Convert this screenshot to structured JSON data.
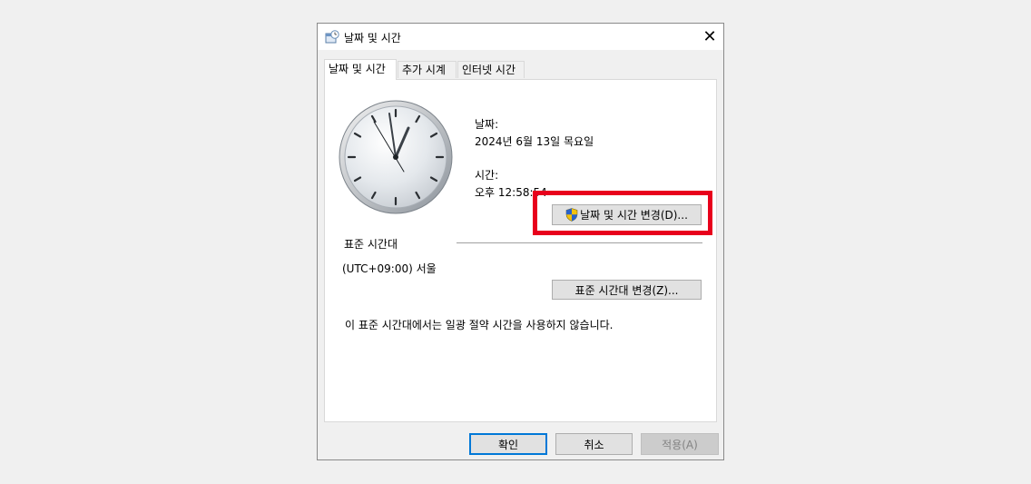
{
  "dialog": {
    "title": "날짜 및 시간",
    "close_glyph": "✕"
  },
  "tabs": [
    {
      "label": "날짜 및 시간",
      "active": true
    },
    {
      "label": "추가 시계",
      "active": false
    },
    {
      "label": "인터넷 시간",
      "active": false
    }
  ],
  "date_time": {
    "date_label": "날짜:",
    "date_value": "2024년 6월 13일 목요일",
    "time_label": "시간:",
    "time_value": "오후 12:58:54",
    "change_button": "날짜 및 시간 변경(D)..."
  },
  "timezone": {
    "group_label": "표준 시간대",
    "value": "(UTC+09:00) 서울",
    "change_button": "표준 시간대 변경(Z)...",
    "dst_note": "이 표준 시간대에서는 일광 절약 시간을 사용하지 않습니다."
  },
  "footer": {
    "ok": "확인",
    "cancel": "취소",
    "apply": "적용(A)"
  },
  "colors": {
    "highlight": "#e8001c",
    "default_button_border": "#0078d7"
  },
  "icons": {
    "title": "date-time-control-panel-icon",
    "uac": "uac-shield-icon"
  }
}
